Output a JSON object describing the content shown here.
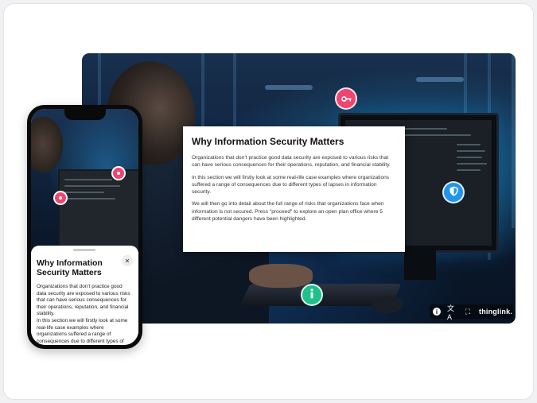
{
  "modal": {
    "title": "Why Information Security Matters",
    "paragraphs": [
      "Organizations that don’t practice good data security are exposed to various risks that can have serious consequences for their operations, reputation, and financial stability.",
      "In this section we will firstly look at some real-life case examples where organizations suffered a range of consequences due to different types of lapses in information security.",
      "We will then go into detail about the full range of risks that organizations face when information is not secured. Press \"proceed\" to explore an open plan office where 5 different potential dangers have been highlighted."
    ]
  },
  "hotspots": {
    "key_icon": "key-icon",
    "shield_icon": "shield-icon",
    "info_icon": "info-icon",
    "colors": {
      "key": "#f0456e",
      "shield": "#2196e8",
      "info": "#1fc08a"
    }
  },
  "toolbar": {
    "info_glyph": "i",
    "translate_glyph": "文A",
    "fullscreen_glyph": "⛶",
    "brand": "thinglink."
  },
  "phone": {
    "title": "Why Information Security Matters",
    "close_glyph": "✕",
    "paragraph1": "Organizations that don’t practice good data security are exposed to various risks that can have serious consequences for their operations, reputation, and financial stability.",
    "paragraph2": "In this section we will firstly look at some real-life case examples where organizations suffered a range of consequences due to different types of lapses r in information security."
  }
}
